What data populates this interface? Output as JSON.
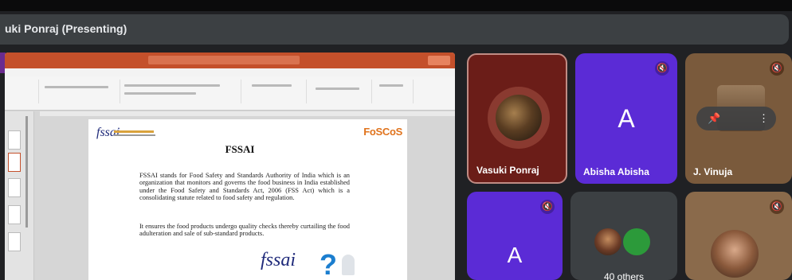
{
  "meeting": {
    "presenting_label": "uki Ponraj (Presenting)"
  },
  "slide": {
    "title": "FSSAI",
    "paragraph1": "FSSAI stands for Food Safety and Standards Authority of India which is an organization that monitors and governs the food business in India established under the Food Safety and Standards Act, 2006 (FSS Act) which is a consolidating statute related to food safety and regulation.",
    "paragraph2": "It ensures the food products undergo quality checks thereby curtailing the food adulteration and sale of sub-standard products.",
    "logo_left": "fssai",
    "logo_right": "FoSCoS",
    "logo_bottom": "fssai"
  },
  "participants": [
    {
      "name": "Vasuki Ponraj",
      "initial": "",
      "muted": false
    },
    {
      "name": "Abisha Abisha",
      "initial": "A",
      "muted": true
    },
    {
      "name": "J. Vinuja",
      "initial": "",
      "muted": true
    },
    {
      "name": "",
      "initial": "A",
      "muted": true
    },
    {
      "name": "",
      "initial": "",
      "muted": true
    }
  ],
  "others_tile": {
    "count_label": "40 others"
  },
  "icons": {
    "mic_off": "mic-off-icon",
    "pin": "pin-icon",
    "more": "more-options-icon"
  },
  "colors": {
    "accent_purple": "#5b2bd6",
    "ppt_orange": "#c4502b",
    "foscos_orange": "#e0731c"
  }
}
